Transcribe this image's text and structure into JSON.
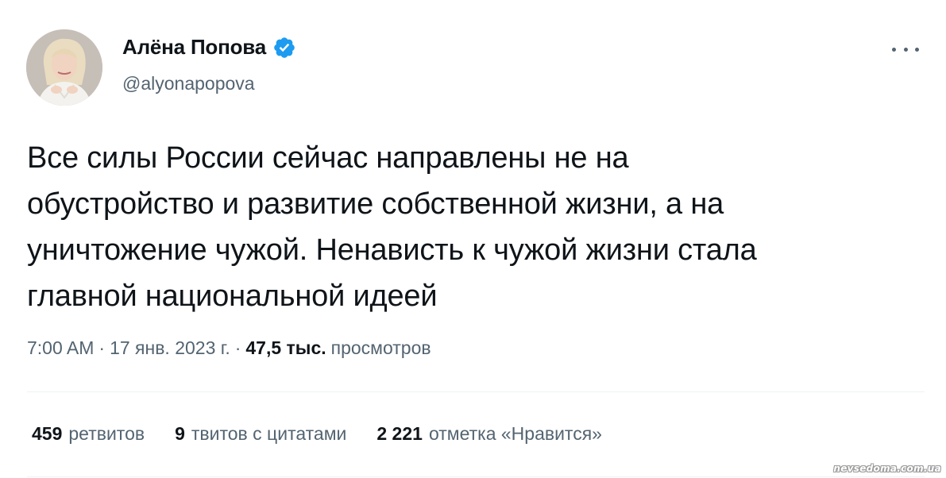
{
  "author": {
    "display_name": "Алёна Попова",
    "handle": "@alyonapopova",
    "verified": true,
    "verified_color": "#1d9bf0"
  },
  "tweet": {
    "text": "Все силы России сейчас направлены не на\nобустройство и развитие собственной жизни, а на\nуничтожение чужой. Ненависть к чужой жизни стала\nглавной национальной идеей",
    "time": "7:00 AM",
    "date": "17 янв. 2023 г.",
    "separator": "·",
    "views_count": "47,5 тыс.",
    "views_label": "просмотров"
  },
  "stats": {
    "retweets_count": "459",
    "retweets_label": "ретвитов",
    "quotes_count": "9",
    "quotes_label": "твитов с цитатами",
    "likes_count": "2 221",
    "likes_label": "отметка «Нравится»"
  },
  "icons": {
    "more": "more-dots-icon",
    "verified": "verified-badge-icon"
  },
  "watermark": "nevsedoma.com.ua",
  "colors": {
    "text_primary": "#0f1419",
    "text_secondary": "#536471",
    "divider": "#eff3f4"
  }
}
